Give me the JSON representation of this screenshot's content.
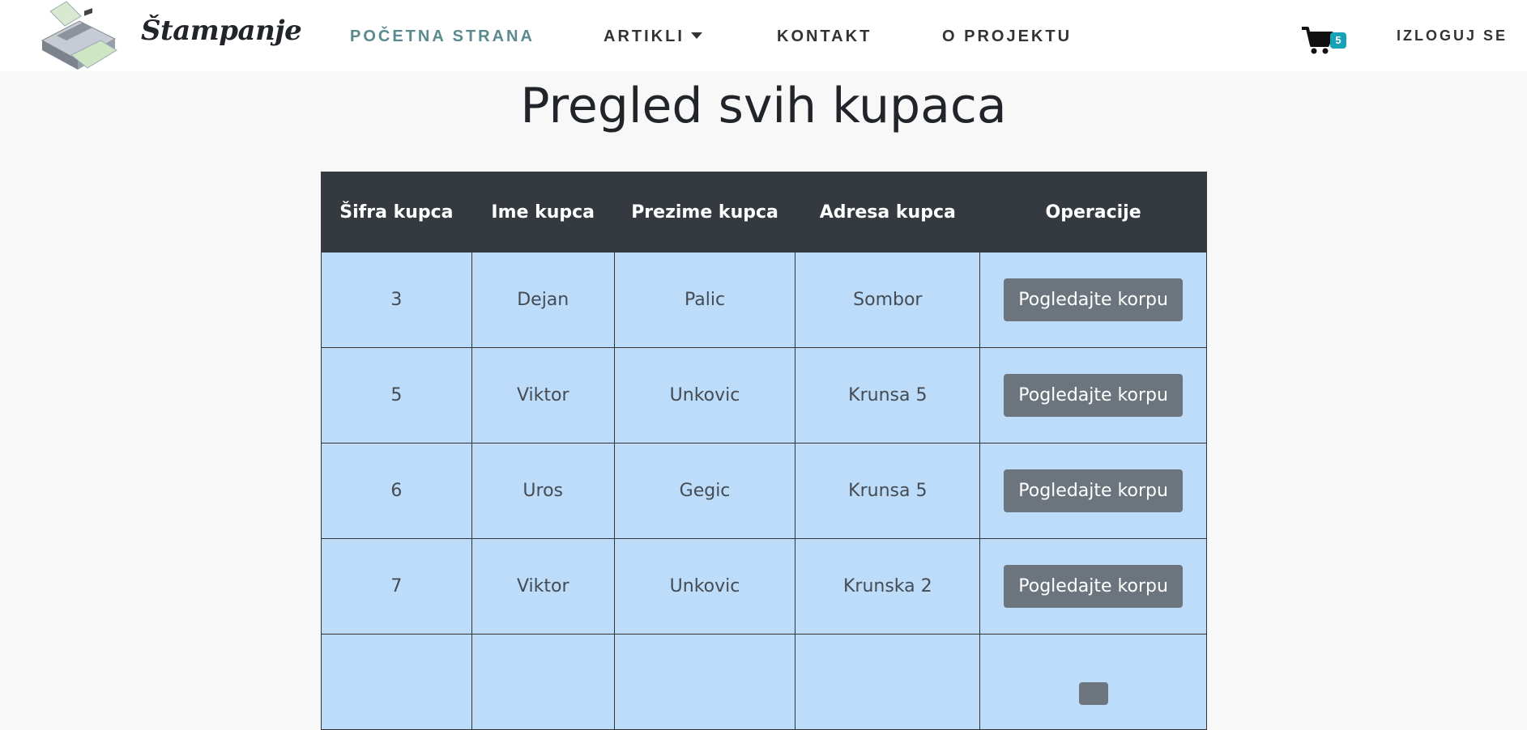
{
  "brand": {
    "name": "Štampanje",
    "logo_icon": "printer-icon"
  },
  "nav": {
    "home": "POČETNA STRANA",
    "articles": "ARTIKLI",
    "contact": "KONTAKT",
    "about": "O PROJEKTU",
    "logout": "IZLOGUJ SE",
    "cart_icon": "cart-icon",
    "cart_count": "5"
  },
  "colors": {
    "active_nav": "#5a8a8f",
    "table_header": "#343a40",
    "row_bg": "#bcdcfa",
    "button": "#6c757d",
    "badge": "#17a2b8"
  },
  "page": {
    "title": "Pregled svih kupaca"
  },
  "table": {
    "headers": [
      "Šifra kupca",
      "Ime kupca",
      "Prezime kupca",
      "Adresa kupca",
      "Operacije"
    ],
    "rows": [
      {
        "id": "3",
        "first": "Dejan",
        "last": "Palic",
        "address": "Sombor",
        "action": "Pogledajte korpu"
      },
      {
        "id": "5",
        "first": "Viktor",
        "last": "Unkovic",
        "address": "Krunsa 5",
        "action": "Pogledajte korpu"
      },
      {
        "id": "6",
        "first": "Uros",
        "last": "Gegic",
        "address": "Krunsa 5",
        "action": "Pogledajte korpu"
      },
      {
        "id": "7",
        "first": "Viktor",
        "last": "Unkovic",
        "address": "Krunska 2",
        "action": "Pogledajte korpu"
      },
      {
        "id": "",
        "first": "",
        "last": "",
        "address": "",
        "action": ""
      }
    ]
  }
}
